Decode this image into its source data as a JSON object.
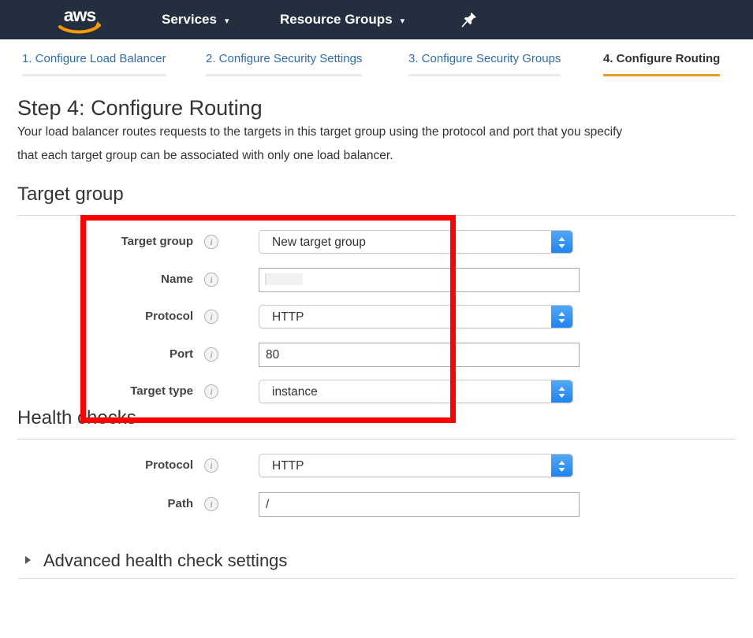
{
  "topnav": {
    "logo_alt": "aws",
    "items": [
      {
        "label": "Services",
        "caret": "⌄"
      },
      {
        "label": "Resource Groups",
        "caret": "⌄"
      }
    ],
    "pin_icon": "pin-icon",
    "background_color": "#232f3e",
    "logo_arrow_color": "#ff9900"
  },
  "tabs": {
    "active_index": 3,
    "active_underline_color": "#ec9a28",
    "link_color": "#2d6cb5",
    "items": [
      {
        "label": "1. Configure Load Balancer",
        "active": false
      },
      {
        "label": "2. Configure Security Settings",
        "active": false
      },
      {
        "label": "3. Configure Security Groups",
        "active": false
      },
      {
        "label": "4. Configure Routing",
        "active": true
      }
    ]
  },
  "page": {
    "title": "Step 4: Configure Routing",
    "description_line_1": "Your load balancer routes requests to the targets in this target group using the protocol and port that you specify",
    "description_line_2": "that each target group can be associated with only one load balancer."
  },
  "target_group_section": {
    "heading": "Target group",
    "rows": [
      {
        "label": "Target group",
        "info": "info-icon",
        "control": "select",
        "value": "New target group"
      },
      {
        "label": "Name",
        "info": "info-icon",
        "control": "input",
        "value": ""
      },
      {
        "label": "Protocol",
        "info": "info-icon",
        "control": "select",
        "value": "HTTP"
      },
      {
        "label": "Port",
        "info": "info-icon",
        "control": "input",
        "value": "80"
      },
      {
        "label": "Target type",
        "info": "info-icon",
        "control": "select",
        "value": "instance"
      }
    ]
  },
  "health_checks_section": {
    "heading": "Health checks",
    "rows": [
      {
        "label": "Protocol",
        "info": "info-icon",
        "control": "select",
        "value": "HTTP"
      },
      {
        "label": "Path",
        "info": "info-icon",
        "control": "input",
        "value": "/"
      }
    ]
  },
  "advanced": {
    "label": "Advanced health check settings",
    "expanded": false,
    "caret": "disclosure-triangle-right-icon"
  },
  "annotation": {
    "shape": "rectangle",
    "color": "#fd0000",
    "stroke_width": 7
  }
}
